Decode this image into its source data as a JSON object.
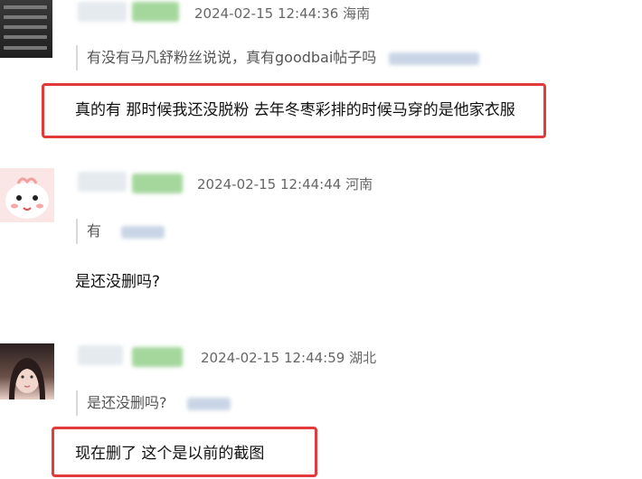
{
  "colors": {
    "highlight": "#e23a3a",
    "meta_text": "#666666",
    "quote_bar": "#d9d9d9"
  },
  "comments": [
    {
      "avatar_icon": "user-avatar-icon",
      "timestamp": "2024-02-15 12:44:36",
      "location": "海南",
      "quote": "有没有马凡舒粉丝说说，真有goodbai帖子吗",
      "reply": "真的有 那时候我还没脱粉 去年冬枣彩排的时候马穿的是他家衣服",
      "highlighted": true
    },
    {
      "avatar_icon": "cartoon-avatar-icon",
      "timestamp": "2024-02-15 12:44:44",
      "location": "河南",
      "quote": "有",
      "reply": "是还没删吗?",
      "highlighted": false
    },
    {
      "avatar_icon": "photo-avatar-icon",
      "timestamp": "2024-02-15 12:44:59",
      "location": "湖北",
      "quote": "是还没删吗?",
      "reply": "现在删了 这个是以前的截图",
      "highlighted": true
    }
  ]
}
